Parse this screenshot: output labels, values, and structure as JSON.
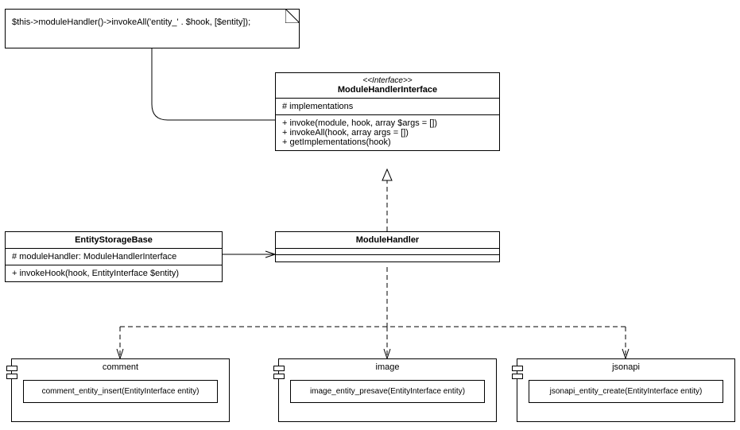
{
  "note": {
    "text": "$this->moduleHandler()->invokeAll('entity_' . $hook, [$entity]);"
  },
  "interface": {
    "stereotype": "<<Interface>>",
    "name": "ModuleHandlerInterface",
    "attributes": "# implementations",
    "op1": "+ invoke(module, hook, array $args = [])",
    "op2": "+ invokeAll(hook, array args = [])",
    "op3": "+ getImplementations(hook)"
  },
  "entityStorageBase": {
    "name": "EntityStorageBase",
    "attr": "# moduleHandler: ModuleHandlerInterface",
    "op": "+ invokeHook(hook, EntityInterface $entity)"
  },
  "moduleHandler": {
    "name": "ModuleHandler"
  },
  "comment": {
    "name": "comment",
    "fn": "comment_entity_insert(EntityInterface entity)"
  },
  "image": {
    "name": "image",
    "fn": "image_entity_presave(EntityInterface entity)"
  },
  "jsonapi": {
    "name": "jsonapi",
    "fn": "jsonapi_entity_create(EntityInterface entity)"
  }
}
